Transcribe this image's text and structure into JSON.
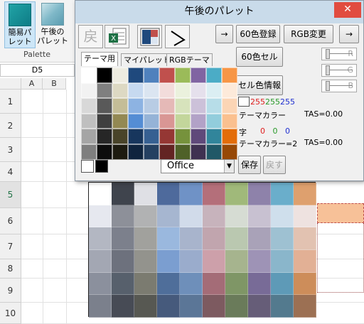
{
  "ribbon": {
    "buttons": [
      {
        "label": "簡易パ\nレット",
        "icon": "palette-icon"
      },
      {
        "label": "午後の\nパレット",
        "icon": "palette-icon"
      }
    ],
    "group_label": "Palette"
  },
  "formula_bar": {
    "name_box": "D5"
  },
  "sheet": {
    "columns": [
      "A",
      "B"
    ],
    "rows": [
      "1",
      "2",
      "3",
      "4",
      "5",
      "6",
      "7",
      "8",
      "9",
      "10"
    ],
    "selected_row": "5"
  },
  "dialog": {
    "title": "午後のパレット",
    "close_icon": "close-icon",
    "tools": [
      "戻",
      "sheet-icon",
      "swatch-icon",
      "shape-icon"
    ],
    "buttons": {
      "arrow_left": "→",
      "register_60": "60色登録",
      "rgb_change": "RGB変更",
      "arrow_right": "→",
      "cell_60": "60色セル",
      "cell_info": "セル色情報",
      "save": "保存",
      "undo": "戻す"
    },
    "tabs": [
      "テーマ用",
      "マイパレット",
      "RGBテーマ"
    ],
    "active_tab": "テーマ用",
    "rgb_fields": {
      "r": "R",
      "g": "G",
      "b": "B"
    },
    "info": {
      "rgb1": {
        "r": "255",
        "g": "255",
        "b": "255"
      },
      "theme_color1": "テーマカラー",
      "tas1": "TAS=0.00",
      "char_label": "字",
      "rgb2": {
        "r": "0",
        "g": "0",
        "b": "0"
      },
      "theme_color2": "テーマカラー=2",
      "tas2": "TAS=0.00"
    },
    "theme_select": "Office",
    "palette_colors": [
      [
        "#ffffff",
        "#000000",
        "#eeece1",
        "#1f497d",
        "#4f81bd",
        "#c0504d",
        "#9bbb59",
        "#8064a2",
        "#4bacc6",
        "#f79646"
      ],
      [
        "#f2f2f2",
        "#7f7f7f",
        "#ddd9c3",
        "#c6d9f0",
        "#dbe5f1",
        "#f2dcdb",
        "#ebf1dd",
        "#e5e0ec",
        "#dbeef3",
        "#fdeada"
      ],
      [
        "#d8d8d8",
        "#595959",
        "#c4bd97",
        "#8db3e2",
        "#b8cce4",
        "#e5b9b7",
        "#d7e3bc",
        "#ccc1d9",
        "#b7dde8",
        "#fbd5b5"
      ],
      [
        "#bfbfbf",
        "#3f3f3f",
        "#938953",
        "#548dd4",
        "#95b3d7",
        "#d99694",
        "#c3d69b",
        "#b2a2c7",
        "#92cddc",
        "#fac08f"
      ],
      [
        "#a5a5a5",
        "#262626",
        "#494429",
        "#17365d",
        "#366092",
        "#953734",
        "#76923c",
        "#5f497a",
        "#31859b",
        "#e36c09"
      ],
      [
        "#7f7f7f",
        "#0c0c0c",
        "#1d1b10",
        "#0f243e",
        "#244061",
        "#632423",
        "#4f6128",
        "#3f3151",
        "#205867",
        "#974806"
      ]
    ],
    "selected_colors": {
      "fill": "#ffffff",
      "text": "#000000"
    }
  },
  "sheet_palette": [
    [
      "#ffffff",
      "#3f444d",
      "#dfe0e5",
      "#4e6a9c",
      "#6f92c6",
      "#b46f7a",
      "#a0b97a",
      "#8e82aa",
      "#6aaecb",
      "#dea06e"
    ],
    [
      "#e6e8ef",
      "#8d9099",
      "#b1b2b3",
      "#a6b6d0",
      "#d1dbea",
      "#c7b3bc",
      "#d6dcd3",
      "#c8c1d1",
      "#cfdfec",
      "#eee2e0"
    ],
    [
      "#b3b7c2",
      "#7c808c",
      "#a1a19d",
      "#9ab8de",
      "#a8b4cc",
      "#c1a5ae",
      "#bac8b0",
      "#a9a2b8",
      "#9ec1d2",
      "#e2c2b1"
    ],
    [
      "#a3a7b3",
      "#6d717d",
      "#93938d",
      "#7b9ed0",
      "#9aaccc",
      "#cda0aa",
      "#a6b48e",
      "#9e93b6",
      "#8ab6cb",
      "#e2b095"
    ],
    [
      "#8b909d",
      "#57606c",
      "#7b7b70",
      "#4f6e9a",
      "#6e8fba",
      "#a46c77",
      "#7f9666",
      "#786b97",
      "#5e9ab7",
      "#cd8d5a"
    ],
    [
      "#7b808c",
      "#474b55",
      "#575852",
      "#465a7c",
      "#5b7697",
      "#7d5a60",
      "#6a7b5a",
      "#665d78",
      "#537a8e",
      "#9c7053"
    ]
  ]
}
